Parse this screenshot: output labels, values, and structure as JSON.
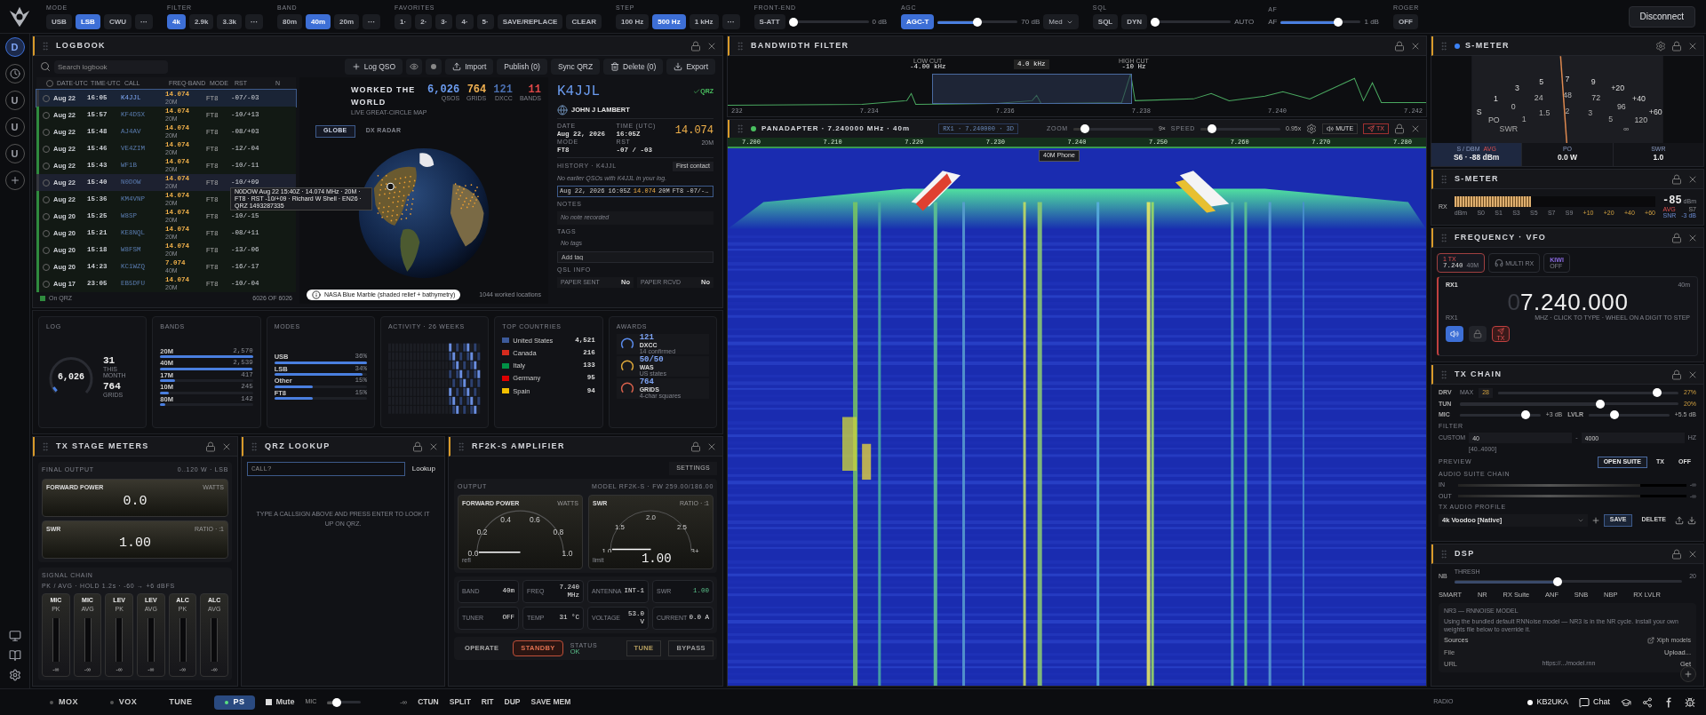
{
  "sidebar": {
    "items": [
      {
        "kind": "letter",
        "label": "D",
        "selected": true
      },
      {
        "kind": "clock",
        "selected": false
      },
      {
        "kind": "letter",
        "label": "U",
        "selected": false
      },
      {
        "kind": "letter",
        "label": "U",
        "selected": false
      },
      {
        "kind": "letter",
        "label": "U",
        "selected": false
      },
      {
        "kind": "add",
        "selected": false
      }
    ]
  },
  "toolbar": {
    "groups": [
      {
        "label": "MODE",
        "items": [
          {
            "kind": "button",
            "label": "USB",
            "selected": false
          },
          {
            "kind": "button",
            "label": "LSB",
            "selected": true
          },
          {
            "kind": "button",
            "label": "CWU",
            "selected": false
          },
          {
            "kind": "button",
            "label": "···",
            "selected": false
          }
        ]
      },
      {
        "label": "FILTER",
        "items": [
          {
            "kind": "button",
            "label": "4k",
            "selected": true
          },
          {
            "kind": "button",
            "label": "2.9k",
            "selected": false
          },
          {
            "kind": "button",
            "label": "3.3k",
            "selected": false
          },
          {
            "kind": "button",
            "label": "···",
            "selected": false
          }
        ]
      },
      {
        "label": "BAND",
        "items": [
          {
            "kind": "button",
            "label": "80m",
            "selected": false
          },
          {
            "kind": "button",
            "label": "40m",
            "selected": true
          },
          {
            "kind": "button",
            "label": "20m",
            "selected": false
          },
          {
            "kind": "button",
            "label": "···",
            "selected": false
          }
        ]
      },
      {
        "label": "FAVORITES",
        "items": [
          {
            "kind": "button",
            "label": "1·",
            "selected": false
          },
          {
            "kind": "button",
            "label": "2·",
            "selected": false
          },
          {
            "kind": "button",
            "label": "3·",
            "selected": false
          },
          {
            "kind": "button",
            "label": "4·",
            "selected": false
          },
          {
            "kind": "button",
            "label": "5·",
            "selected": false
          },
          {
            "kind": "button",
            "label": "SAVE/REPLACE",
            "selected": false
          },
          {
            "kind": "button",
            "label": "CLEAR",
            "selected": false
          }
        ]
      },
      {
        "label": "STEP",
        "items": [
          {
            "kind": "button",
            "label": "100 Hz",
            "selected": false
          },
          {
            "kind": "button",
            "label": "500 Hz",
            "selected": true
          },
          {
            "kind": "button",
            "label": "1 kHz",
            "selected": false
          },
          {
            "kind": "button",
            "label": "···",
            "selected": false
          }
        ]
      },
      {
        "label": "FRONT-END",
        "items": [
          {
            "kind": "button",
            "label": "S-ATT",
            "selected": false
          },
          {
            "kind": "slider",
            "level": 0.0
          },
          {
            "kind": "reading",
            "text": "0 dB"
          }
        ]
      },
      {
        "label": "AGC",
        "items": [
          {
            "kind": "button",
            "label": "AGC-T",
            "selected": true
          },
          {
            "kind": "slider",
            "level": 0.5
          },
          {
            "kind": "reading",
            "text": "70 dB"
          },
          {
            "kind": "select",
            "text": "Med"
          }
        ]
      },
      {
        "label": "SQL",
        "items": [
          {
            "kind": "button",
            "label": "SQL",
            "selected": false
          },
          {
            "kind": "button",
            "label": "DYN",
            "selected": false
          },
          {
            "kind": "slider",
            "level": 0.0
          },
          {
            "kind": "reading",
            "text": "AUTO"
          }
        ]
      },
      {
        "label": "AF",
        "items": [
          {
            "kind": "reading",
            "text": "AF"
          },
          {
            "kind": "slider",
            "level": 0.75
          },
          {
            "kind": "reading",
            "text": "1 dB"
          }
        ]
      },
      {
        "label": "ROGER",
        "items": [
          {
            "kind": "button",
            "label": "OFF",
            "selected": false
          }
        ]
      }
    ],
    "disconnect": "Disconnect"
  },
  "logbook": {
    "title": "LOGBOOK",
    "search_placeholder": "Search logbook",
    "actions": [
      {
        "kind": "add",
        "label": "Log QSO"
      },
      {
        "kind": "eye"
      },
      {
        "kind": "dot"
      },
      {
        "kind": "import",
        "label": "Import"
      },
      {
        "kind": "text",
        "label": "Publish (0)"
      },
      {
        "kind": "text",
        "label": "Sync QRZ"
      },
      {
        "kind": "delete",
        "label": "Delete (0)"
      },
      {
        "kind": "export",
        "label": "Export"
      }
    ],
    "all_checked": false,
    "columns": [
      "DATE·UTC",
      "TIME·UTC",
      "CALL",
      "FREQ·BAND",
      "MODE",
      "RST",
      "N"
    ],
    "rows": [
      {
        "date": "Aug 22",
        "time": "16:05",
        "call": "K4JJL",
        "checked": false,
        "freq": "14.074",
        "band": "20M",
        "mode": "FT8",
        "rst": "-07/-03",
        "selected": true,
        "hovered": false,
        "on_qrz": false
      },
      {
        "date": "Aug 22",
        "time": "15:57",
        "call": "KF4DSX",
        "checked": false,
        "freq": "14.074",
        "band": "20M",
        "mode": "FT8",
        "rst": "-10/+13",
        "selected": false,
        "hovered": false,
        "on_qrz": true
      },
      {
        "date": "Aug 22",
        "time": "15:48",
        "call": "AJ4AV",
        "checked": false,
        "freq": "14.074",
        "band": "20M",
        "mode": "FT8",
        "rst": "-08/+03",
        "selected": false,
        "hovered": false,
        "on_qrz": true
      },
      {
        "date": "Aug 22",
        "time": "15:46",
        "call": "VE4ZIM",
        "checked": false,
        "freq": "14.074",
        "band": "20M",
        "mode": "FT8",
        "rst": "-12/-04",
        "selected": false,
        "hovered": false,
        "on_qrz": true
      },
      {
        "date": "Aug 22",
        "time": "15:43",
        "call": "WF1B",
        "checked": false,
        "freq": "14.074",
        "band": "20M",
        "mode": "FT8",
        "rst": "-10/-11",
        "selected": false,
        "hovered": false,
        "on_qrz": true
      },
      {
        "date": "Aug 22",
        "time": "15:40",
        "call": "N0DOW",
        "checked": false,
        "freq": "14.074",
        "band": "20M",
        "mode": "FT8",
        "rst": "-10/+09",
        "selected": false,
        "hovered": true,
        "on_qrz": false
      },
      {
        "date": "Aug 22",
        "time": "15:36",
        "call": "KM4VNP",
        "checked": false,
        "freq": "14.074",
        "band": "20M",
        "mode": "FT8",
        "selected": false,
        "hovered": false,
        "on_qrz": true
      },
      {
        "date": "Aug 20",
        "time": "15:25",
        "call": "W8SP",
        "checked": false,
        "freq": "14.074",
        "band": "20M",
        "mode": "FT8",
        "rst": "-10/-15",
        "selected": false,
        "hovered": false,
        "on_qrz": true
      },
      {
        "date": "Aug 20",
        "time": "15:21",
        "call": "KE8NQL",
        "checked": false,
        "freq": "14.074",
        "band": "20M",
        "mode": "FT8",
        "rst": "-08/+11",
        "selected": false,
        "hovered": false,
        "on_qrz": true
      },
      {
        "date": "Aug 20",
        "time": "15:18",
        "call": "W8FSM",
        "checked": false,
        "freq": "14.074",
        "band": "20M",
        "mode": "FT8",
        "rst": "-13/-06",
        "selected": false,
        "hovered": false,
        "on_qrz": true
      },
      {
        "date": "Aug 20",
        "time": "14:23",
        "call": "KC1WZQ",
        "checked": false,
        "freq": "7.074",
        "band": "40M",
        "mode": "FT8",
        "rst": "-16/-17",
        "selected": false,
        "hovered": false,
        "on_qrz": true
      },
      {
        "date": "Aug 17",
        "time": "23:05",
        "call": "EB5DFU",
        "checked": false,
        "freq": "14.074",
        "band": "20M",
        "mode": "FT8",
        "rst": "-10/-04",
        "selected": false,
        "hovered": false,
        "on_qrz": true
      }
    ],
    "footer": {
      "legend": "On QRZ",
      "count": "6026 OF 6026"
    },
    "tooltip": "N0DOW Aug 22 15:40Z · 14.074 MHz · 20M · FT8 · RST -10/+09 · Richard W Shell · EN26 · QRZ 1493287335"
  },
  "world": {
    "title": "WORKED THE WORLD",
    "subtitle": "LIVE GREAT-CIRCLE MAP",
    "stats": [
      {
        "value": "6,026",
        "label": "QSOS",
        "color": "#6b9cf0"
      },
      {
        "value": "764",
        "label": "GRIDS",
        "color": "#f0b050"
      },
      {
        "value": "121",
        "label": "DXCC",
        "color": "#4a6fb0"
      },
      {
        "value": "11",
        "label": "BANDS",
        "color": "#e04848"
      }
    ],
    "tabs": [
      {
        "label": "GLOBE",
        "selected": true
      },
      {
        "label": "DX RADAR",
        "selected": false
      }
    ],
    "credit": "NASA Blue Marble (shaded relief + bathymetry)",
    "locations": "1044 worked locations"
  },
  "contact": {
    "call": "K4JJL",
    "qrz": "QRZ",
    "name": "JOHN J LAMBERT",
    "fields": [
      {
        "label": "DATE",
        "value": "Aug 22, 2026"
      },
      {
        "label": "TIME (UTC)",
        "value": "16:05Z"
      },
      {
        "label": "MODE",
        "value": "FT8"
      },
      {
        "label": "RST",
        "value": "-07 / -03"
      }
    ],
    "freq": "14.074",
    "band": "20M",
    "history_label": "HISTORY · K4JJL",
    "history_badge": "First contact",
    "history_note": "No earlier QSOs with K4JJL in your log.",
    "history_entry": {
      "date": "Aug 22, 2026 16:05Z",
      "freq": "14.074",
      "band": "20M",
      "mode": "FT8",
      "rst": "-07/-…"
    },
    "notes_label": "NOTES",
    "notes": "No note recorded",
    "tags_label": "TAGS",
    "tags": "No tags",
    "tag_placeholder": "Add tag",
    "qsl_label": "QSL INFO",
    "qsl": [
      {
        "label": "PAPER SENT",
        "value": "No"
      },
      {
        "label": "PAPER RCVD",
        "value": "No"
      }
    ]
  },
  "stats": {
    "log": {
      "title": "LOG",
      "total": "6,026",
      "level": 0.05,
      "items": [
        {
          "value": "31",
          "label": "THIS MONTH"
        },
        {
          "value": "764",
          "label": "GRIDS"
        }
      ]
    },
    "bands": {
      "title": "BANDS",
      "items": [
        {
          "name": "20M",
          "count": "2,570",
          "level": 1
        },
        {
          "name": "40M",
          "count": "2,539",
          "level": 0.99
        },
        {
          "name": "17M",
          "count": "417",
          "level": 0.16
        },
        {
          "name": "10M",
          "count": "245",
          "level": 0.09
        },
        {
          "name": "80M",
          "count": "142",
          "level": 0.05
        }
      ]
    },
    "modes": {
      "title": "MODES",
      "items": [
        {
          "name": "USB",
          "share": "36%",
          "level": 1
        },
        {
          "name": "LSB",
          "share": "34%",
          "level": 0.95
        },
        {
          "name": "Other",
          "share": "15%",
          "level": 0.42
        },
        {
          "name": "FT8",
          "share": "15%",
          "level": 0.42
        }
      ]
    },
    "activity": {
      "title": "ACTIVITY · 26 WEEKS"
    },
    "countries": {
      "title": "TOP COUNTRIES",
      "items": [
        {
          "name": "United States",
          "count": "4,521",
          "color": "#3c5a9a"
        },
        {
          "name": "Canada",
          "count": "216",
          "color": "#d52b1e"
        },
        {
          "name": "Italy",
          "count": "133",
          "color": "#009246"
        },
        {
          "name": "Germany",
          "count": "95",
          "color": "#dd0000"
        },
        {
          "name": "Spain",
          "count": "94",
          "color": "#f1bf00"
        }
      ]
    },
    "awards": {
      "title": "AWARDS",
      "items": [
        {
          "value": "121",
          "label": "DXCC",
          "sub": "14 confirmed",
          "color": "#5b8def"
        },
        {
          "value": "50/50",
          "label": "WAS",
          "sub": "US states",
          "color": "#e0a93a"
        },
        {
          "value": "764",
          "label": "GRIDS",
          "sub": "4-char squares",
          "color": "#d9614c"
        }
      ]
    }
  },
  "tx_stage": {
    "title": "TX STAGE METERS",
    "final_label": "FINAL OUTPUT",
    "final_range": "0..120 W · LSB",
    "gauges": [
      {
        "label": "FORWARD POWER",
        "unit": "WATTS",
        "value": "0.0"
      },
      {
        "label": "SWR",
        "unit": "RATIO · :1",
        "value": "1.00"
      }
    ],
    "chain_label": "SIGNAL CHAIN",
    "chain_info": "PK / AVG · HOLD 1.2s · -60 → +6 dBFS",
    "meters": [
      {
        "name": "MIC",
        "kind": "PK",
        "reading": "-∞"
      },
      {
        "name": "MIC",
        "kind": "AVG",
        "reading": "-∞"
      },
      {
        "name": "LEV",
        "kind": "PK",
        "reading": "-∞"
      },
      {
        "name": "LEV",
        "kind": "AVG",
        "reading": "-∞"
      },
      {
        "name": "ALC",
        "kind": "PK",
        "reading": "-∞"
      },
      {
        "name": "ALC",
        "kind": "AVG",
        "reading": "-∞"
      }
    ]
  },
  "qrz": {
    "title": "QRZ LOOKUP",
    "placeholder": "CALL?",
    "button": "Lookup",
    "hint": "TYPE A CALLSIGN ABOVE AND PRESS ENTER TO LOOK IT UP ON QRZ."
  },
  "amp": {
    "title": "RF2K-S AMPLIFIER",
    "settings": "SETTINGS",
    "output_label": "OUTPUT",
    "model": "MODEL RF2K-S · FW 259.00/186.00",
    "gauges": [
      {
        "label": "FORWARD POWER",
        "unit": "WATTS",
        "ticks": [
          "0.0",
          "0.2",
          "0.4",
          "0.6",
          "0.8",
          "1.0"
        ],
        "foot": "refl"
      },
      {
        "label": "SWR",
        "unit": "RATIO · :1",
        "ticks": [
          "1.0",
          "1.5",
          "2.0",
          "2.5",
          "3+"
        ],
        "value": "1.00",
        "foot": "limit"
      }
    ],
    "info": [
      {
        "label": "BAND",
        "value": "40m",
        "kind": "plain"
      },
      {
        "label": "FREQ",
        "value": "7.240 MHz",
        "kind": "plain"
      },
      {
        "label": "ANTENNA",
        "value": "INT-1",
        "kind": "plain"
      },
      {
        "label": "SWR",
        "value": "1.00",
        "kind": "ok"
      },
      {
        "label": "TUNER",
        "value": "OFF",
        "kind": "plain"
      },
      {
        "label": "TEMP",
        "value": "31 °C",
        "kind": "plain"
      },
      {
        "label": "VOLTAGE",
        "value": "53.0 V",
        "kind": "plain"
      },
      {
        "label": "CURRENT",
        "value": "0.0 A",
        "kind": "plain"
      }
    ],
    "controls": [
      {
        "label": "OPERATE",
        "selected": false
      },
      {
        "label": "STANDBY",
        "selected": true
      }
    ],
    "status_label": "STATUS",
    "status": "OK",
    "modes": [
      {
        "label": "TUNE",
        "selected": true
      },
      {
        "label": "BYPASS",
        "selected": false
      }
    ]
  },
  "bandwidth": {
    "title": "BANDWIDTH FILTER",
    "low_label": "LOW CUT",
    "low": "-4.00 kHz",
    "width": "4.0 kHz",
    "high_label": "HIGH CUT",
    "high": "-10 Hz",
    "axis": [
      "232",
      "7.234",
      "7.236",
      "7.238",
      "7.240",
      "7.242"
    ]
  },
  "panadapter": {
    "title": "PANADAPTER · 7.240000 MHz · 40m",
    "rx": "RX1 · 7.240000 · 3D",
    "zoom": {
      "label": "ZOOM",
      "level": 0.1,
      "reading": "9×"
    },
    "speed": {
      "label": "SPEED",
      "level": 0.1,
      "reading": "0.95x"
    },
    "mute": "MUTE",
    "tx": "TX",
    "axis": [
      "7.200",
      "7.210",
      "7.220",
      "7.230",
      "7.240",
      "7.250",
      "7.260",
      "7.270",
      "7.280"
    ],
    "marker": "40M Phone"
  },
  "smeter": {
    "title": "S-METER",
    "s_scale": [
      "S",
      "1",
      "3",
      "5",
      "7",
      "9",
      "+20",
      "+40",
      "+60"
    ],
    "po_scale": [
      "PO",
      "0",
      "24",
      "48",
      "72",
      "96",
      "120"
    ],
    "swr_scale": [
      "SWR",
      "1",
      "1.5",
      "2",
      "3",
      "5",
      "∞"
    ],
    "level": 0.47,
    "readouts": [
      {
        "label": "S / DBM",
        "badge": "AVG",
        "value": "S6 · -88 dBm",
        "selected": true
      },
      {
        "label": "PO",
        "value": "0.0 W",
        "selected": false
      },
      {
        "label": "SWR",
        "value": "1.0",
        "selected": false
      }
    ]
  },
  "smeter_bar": {
    "title": "S-METER",
    "label": "RX",
    "level": 0.38,
    "value": "-85",
    "unit": "dBm",
    "avg": "AVG",
    "snr": "SNR",
    "s": "S7",
    "snr_value": "-3 dB",
    "scale": [
      "dBm",
      "S0",
      "S1",
      "S3",
      "S5",
      "S7",
      "S9",
      "+10",
      "+20",
      "+40",
      "+60"
    ]
  },
  "vfo": {
    "title": "FREQUENCY · VFO",
    "chips": [
      {
        "kind": "tx",
        "top": "1 TX",
        "value": "7.240",
        "sub": "40M",
        "selected": true
      },
      {
        "kind": "multi",
        "label": "MULTI RX",
        "selected": false
      },
      {
        "kind": "kiwi",
        "label": "KIWI",
        "sub": "OFF",
        "selected": false
      }
    ],
    "rx": "RX1",
    "band": "40m",
    "lead": "0",
    "freq": "7.240.000",
    "rx_label": "RX1",
    "hint": "MHZ · CLICK TO TYPE · WHEEL ON A DIGIT TO STEP",
    "buttons": [
      {
        "kind": "speaker",
        "selected": true
      },
      {
        "kind": "lock",
        "selected": false
      },
      {
        "kind": "tx",
        "label": "TX",
        "selected": false
      }
    ]
  },
  "tx_chain": {
    "title": "TX CHAIN",
    "rows": [
      {
        "kind": "drv",
        "label": "DRV",
        "max_label": "MAX",
        "max": "28",
        "level": 0.9,
        "reading": "27%"
      },
      {
        "kind": "single",
        "label": "TUN",
        "level": 0.65,
        "reading": "20%"
      },
      {
        "kind": "dual",
        "label": "MIC",
        "level": 0.85,
        "reading": "+3 dB",
        "second": {
          "label": "LVLR",
          "level": 0.3,
          "reading": "+5.5 dB"
        }
      }
    ],
    "filter_label": "FILTER",
    "custom_label": "CUSTOM",
    "low": "40",
    "separator": "-",
    "high": "4000",
    "unit": "HZ",
    "range": "[40..4000]",
    "preview_label": "PREVIEW",
    "preview": [
      {
        "label": "OPEN SUITE",
        "selected": true
      },
      {
        "label": "TX",
        "selected": false
      },
      {
        "label": "OFF",
        "selected": false
      }
    ],
    "suite_label": "AUDIO SUITE CHAIN",
    "suite": [
      {
        "label": "IN",
        "level": 0.8,
        "reading": "-∞"
      },
      {
        "label": "OUT",
        "level": 0.8,
        "reading": "-∞"
      }
    ],
    "profile_label": "TX AUDIO PROFILE",
    "profile": "4k Voodoo [Native]",
    "save": "SAVE",
    "delete": "DELETE"
  },
  "dsp": {
    "title": "DSP",
    "nb_label": "NB",
    "thresh_label": "THRESH",
    "nb": {
      "level": 0.45
    },
    "nb_value": "20",
    "buttons": [
      "SMART",
      "NR",
      "RX Suite",
      "ANF",
      "SNB",
      "NBP",
      "RX LVLR"
    ],
    "nr3_title": "NR3 — RNNOISE MODEL",
    "nr3_desc": "Using the bundled default RNNoise model — NR3 is in the NR cycle. Install your own weights file below to override it.",
    "sources": "Sources",
    "xiph": "Xiph models",
    "file_label": "File",
    "upload": "Upload...",
    "url_label": "URL",
    "url_placeholder": "https://.../model.rnn",
    "get": "Get"
  },
  "bottom_bar": {
    "buttons": [
      {
        "label": "MOX",
        "led": true,
        "selected": false
      },
      {
        "label": "VOX",
        "led": true,
        "selected": false
      },
      {
        "label": "TUNE",
        "led": false,
        "selected": false
      },
      {
        "label": "PS",
        "led": true,
        "selected": true
      }
    ],
    "mute": {
      "label": "Mute",
      "checked": false
    },
    "mic": {
      "label": "MIC",
      "level": 0.2,
      "reading": "-∞"
    },
    "actions": [
      "CTUN",
      "SPLIT",
      "RIT",
      "DUP",
      "SAVE MEM"
    ],
    "radio": "RADIO",
    "callsign": "KB2UKA",
    "chat": "Chat"
  }
}
